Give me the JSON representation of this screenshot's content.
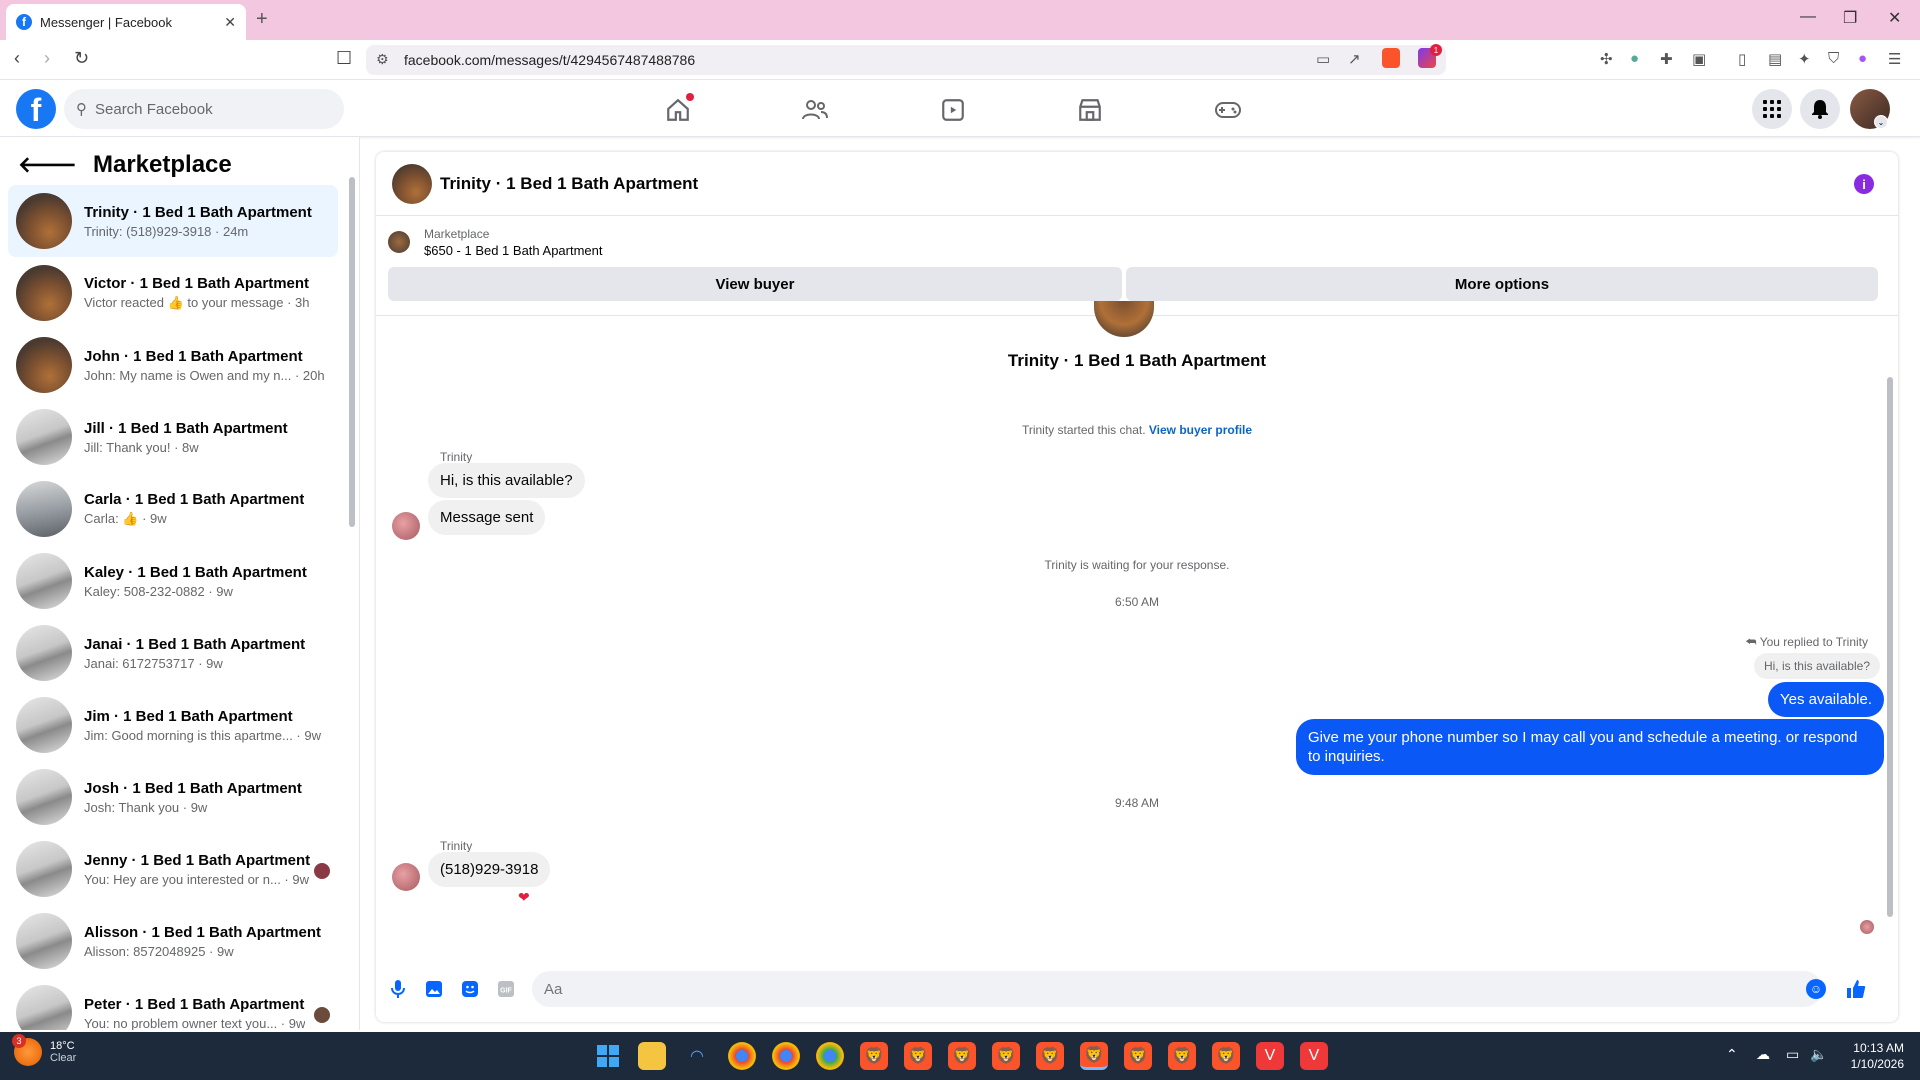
{
  "browser": {
    "tab_title": "Messenger | Facebook",
    "url": "facebook.com/messages/t/4294567487488786",
    "brave_badge_count": "1"
  },
  "fb_header": {
    "search_placeholder": "Search Facebook"
  },
  "sidebar": {
    "title": "Marketplace",
    "conversations": [
      {
        "name": "Trinity · 1 Bed 1 Bath Apartment",
        "preview": "Trinity: (518)929-3918 · 24m",
        "active": true
      },
      {
        "name": "Victor · 1 Bed 1 Bath Apartment",
        "preview": "Victor reacted 👍 to your message · 3h"
      },
      {
        "name": "John · 1 Bed 1 Bath Apartment",
        "preview": "John: My name is Owen and my n... · 20h"
      },
      {
        "name": "Jill · 1 Bed 1 Bath Apartment",
        "preview": "Jill: Thank you! · 8w"
      },
      {
        "name": "Carla · 1 Bed 1 Bath Apartment",
        "preview": "Carla: 👍 · 9w"
      },
      {
        "name": "Kaley · 1 Bed 1 Bath Apartment",
        "preview": "Kaley: 508-232-0882 · 9w"
      },
      {
        "name": "Janai · 1 Bed 1 Bath Apartment",
        "preview": "Janai: 6172753717 · 9w"
      },
      {
        "name": "Jim · 1 Bed 1 Bath Apartment",
        "preview": "Jim: Good morning is this apartme... · 9w"
      },
      {
        "name": "Josh · 1 Bed 1 Bath Apartment",
        "preview": "Josh: Thank you · 9w"
      },
      {
        "name": "Jenny · 1 Bed 1 Bath Apartment",
        "preview": "You: Hey are you interested or n... · 9w"
      },
      {
        "name": "Alisson · 1 Bed 1 Bath Apartment",
        "preview": "Alisson: 8572048925 · 9w"
      },
      {
        "name": "Peter · 1 Bed 1 Bath Apartment",
        "preview": "You: no problem owner text you... · 9w"
      }
    ]
  },
  "chat": {
    "header_title": "Trinity · 1 Bed 1 Bath Apartment",
    "listing_label": "Marketplace",
    "listing_price_title": "$650 - 1 Bed 1 Bath Apartment",
    "view_buyer_label": "View buyer",
    "more_options_label": "More options",
    "conversation_title": "Trinity · 1 Bed 1 Bath Apartment",
    "started_text": "Trinity started this chat.",
    "view_buyer_profile_link": "View buyer profile",
    "sender_name": "Trinity",
    "msg_in_1": "Hi, is this available?",
    "msg_in_2": "Message sent",
    "waiting_text": "Trinity is waiting for your response.",
    "time_1": "6:50 AM",
    "replied_to_text": "You replied to Trinity",
    "quoted_text": "Hi, is this available?",
    "msg_out_1": "Yes available.",
    "msg_out_2": "Give me your phone number so I may call you and schedule a meeting.  or respond to inquiries.",
    "time_2": "9:48 AM",
    "sender_name_2": "Trinity",
    "msg_in_3": "(518)929-3918",
    "composer_placeholder": "Aa"
  },
  "taskbar": {
    "temperature": "18°C",
    "condition": "Clear",
    "weather_badge": "3",
    "time": "10:13 AM",
    "date": "1/10/2026"
  },
  "colors": {
    "fb_blue": "#1877f2",
    "outgoing_bubble": "#0a58f5",
    "active_conv_bg": "#ebf5ff",
    "tabstrip": "#f4c7e0"
  }
}
